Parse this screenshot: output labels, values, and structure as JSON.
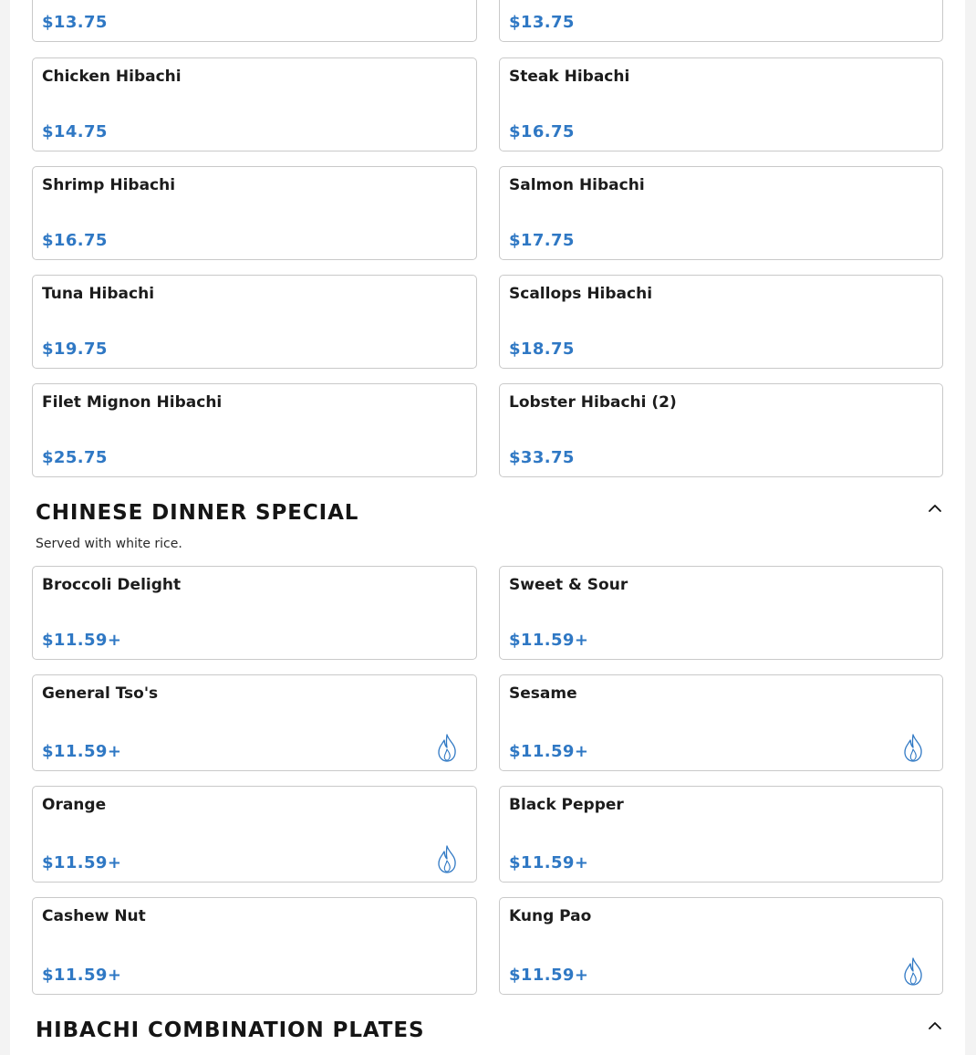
{
  "accent_color": "#2f78c4",
  "top_row": [
    {
      "price": "$13.75"
    },
    {
      "price": "$13.75"
    }
  ],
  "hibachi_items": [
    {
      "name": "Chicken Hibachi",
      "price": "$14.75"
    },
    {
      "name": "Steak Hibachi",
      "price": "$16.75"
    },
    {
      "name": "Shrimp Hibachi",
      "price": "$16.75"
    },
    {
      "name": "Salmon Hibachi",
      "price": "$17.75"
    },
    {
      "name": "Tuna Hibachi",
      "price": "$19.75"
    },
    {
      "name": "Scallops Hibachi",
      "price": "$18.75"
    },
    {
      "name": "Filet Mignon Hibachi",
      "price": "$25.75"
    },
    {
      "name": "Lobster Hibachi (2)",
      "price": "$33.75"
    }
  ],
  "chinese_dinner": {
    "title": "CHINESE DINNER SPECIAL",
    "description": "Served with white rice.",
    "items": [
      {
        "name": "Broccoli Delight",
        "price": "$11.59+",
        "spicy": false
      },
      {
        "name": "Sweet & Sour",
        "price": "$11.59+",
        "spicy": false
      },
      {
        "name": "General Tso's",
        "price": "$11.59+",
        "spicy": true
      },
      {
        "name": "Sesame",
        "price": "$11.59+",
        "spicy": true
      },
      {
        "name": "Orange",
        "price": "$11.59+",
        "spicy": true
      },
      {
        "name": "Black Pepper",
        "price": "$11.59+",
        "spicy": false
      },
      {
        "name": "Cashew Nut",
        "price": "$11.59+",
        "spicy": false
      },
      {
        "name": "Kung Pao",
        "price": "$11.59+",
        "spicy": true
      }
    ]
  },
  "combination": {
    "title": "HIBACHI COMBINATION PLATES"
  },
  "icons": {
    "spicy": "flame-icon",
    "collapse": "chevron-up-icon"
  }
}
